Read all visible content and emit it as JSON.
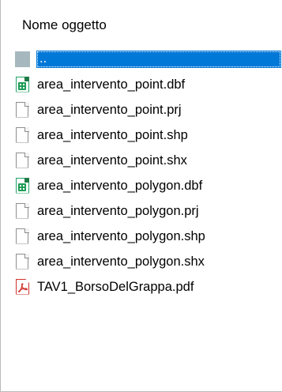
{
  "header": {
    "column_label": "Nome oggetto"
  },
  "files": [
    {
      "name": "..",
      "icon": "parent-folder-icon",
      "selected": true
    },
    {
      "name": "area_intervento_point.dbf",
      "icon": "spreadsheet-file-icon"
    },
    {
      "name": "area_intervento_point.prj",
      "icon": "generic-file-icon"
    },
    {
      "name": "area_intervento_point.shp",
      "icon": "generic-file-icon"
    },
    {
      "name": "area_intervento_point.shx",
      "icon": "generic-file-icon"
    },
    {
      "name": "area_intervento_polygon.dbf",
      "icon": "spreadsheet-file-icon"
    },
    {
      "name": "area_intervento_polygon.prj",
      "icon": "generic-file-icon"
    },
    {
      "name": "area_intervento_polygon.shp",
      "icon": "generic-file-icon"
    },
    {
      "name": "area_intervento_polygon.shx",
      "icon": "generic-file-icon"
    },
    {
      "name": "TAV1_BorsoDelGrappa.pdf",
      "icon": "pdf-file-icon"
    }
  ],
  "colors": {
    "selection": "#0078d7",
    "spreadsheet": "#1f9d57",
    "pdf": "#d0312d",
    "folder_block": "#a6b8bd"
  }
}
